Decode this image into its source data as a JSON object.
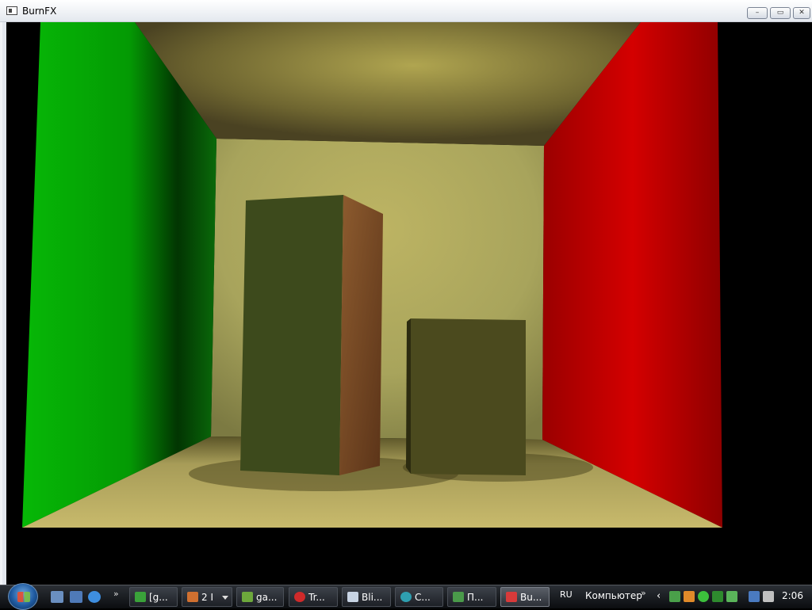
{
  "window": {
    "title": "BurnFX",
    "controls": {
      "minimize": "–",
      "maximize": "▭",
      "close": "✕"
    }
  },
  "scene": {
    "colors": {
      "left_wall": "#06b806",
      "right_wall": "#cc0000",
      "back_wall": "#b9b066",
      "ceiling": "#8a7a3a",
      "floor": "#c2b46a",
      "tall_box_front": "#3d4a1c",
      "tall_box_side": "#8a5a30",
      "short_box_front": "#4b4a1e"
    }
  },
  "taskbar": {
    "quicklaunch_more": "»",
    "tasks": [
      {
        "label": "[g...",
        "icon": "terminal-icon",
        "color": "#3aa23a"
      },
      {
        "label": "2 I",
        "icon": "media-icon",
        "color": "#d07030",
        "has_arrow": true
      },
      {
        "label": "ga...",
        "icon": "folder-icon",
        "color": "#6da83c"
      },
      {
        "label": "Tr...",
        "icon": "opera-icon",
        "color": "#d02a2a"
      },
      {
        "label": "Bli...",
        "icon": "blender-window-icon",
        "color": "#c8d4e4"
      },
      {
        "label": "C...",
        "icon": "app-icon",
        "color": "#2f9fb0"
      },
      {
        "label": "П...",
        "icon": "image-icon",
        "color": "#4a9a4a"
      },
      {
        "label": "Bu...",
        "icon": "burnfx-icon",
        "color": "#d83a3a",
        "active": true
      }
    ],
    "language": "RU",
    "toolbar_label": "Компьютер",
    "toolbar_more": "»",
    "tray_expand": "‹",
    "clock": "2:06"
  }
}
